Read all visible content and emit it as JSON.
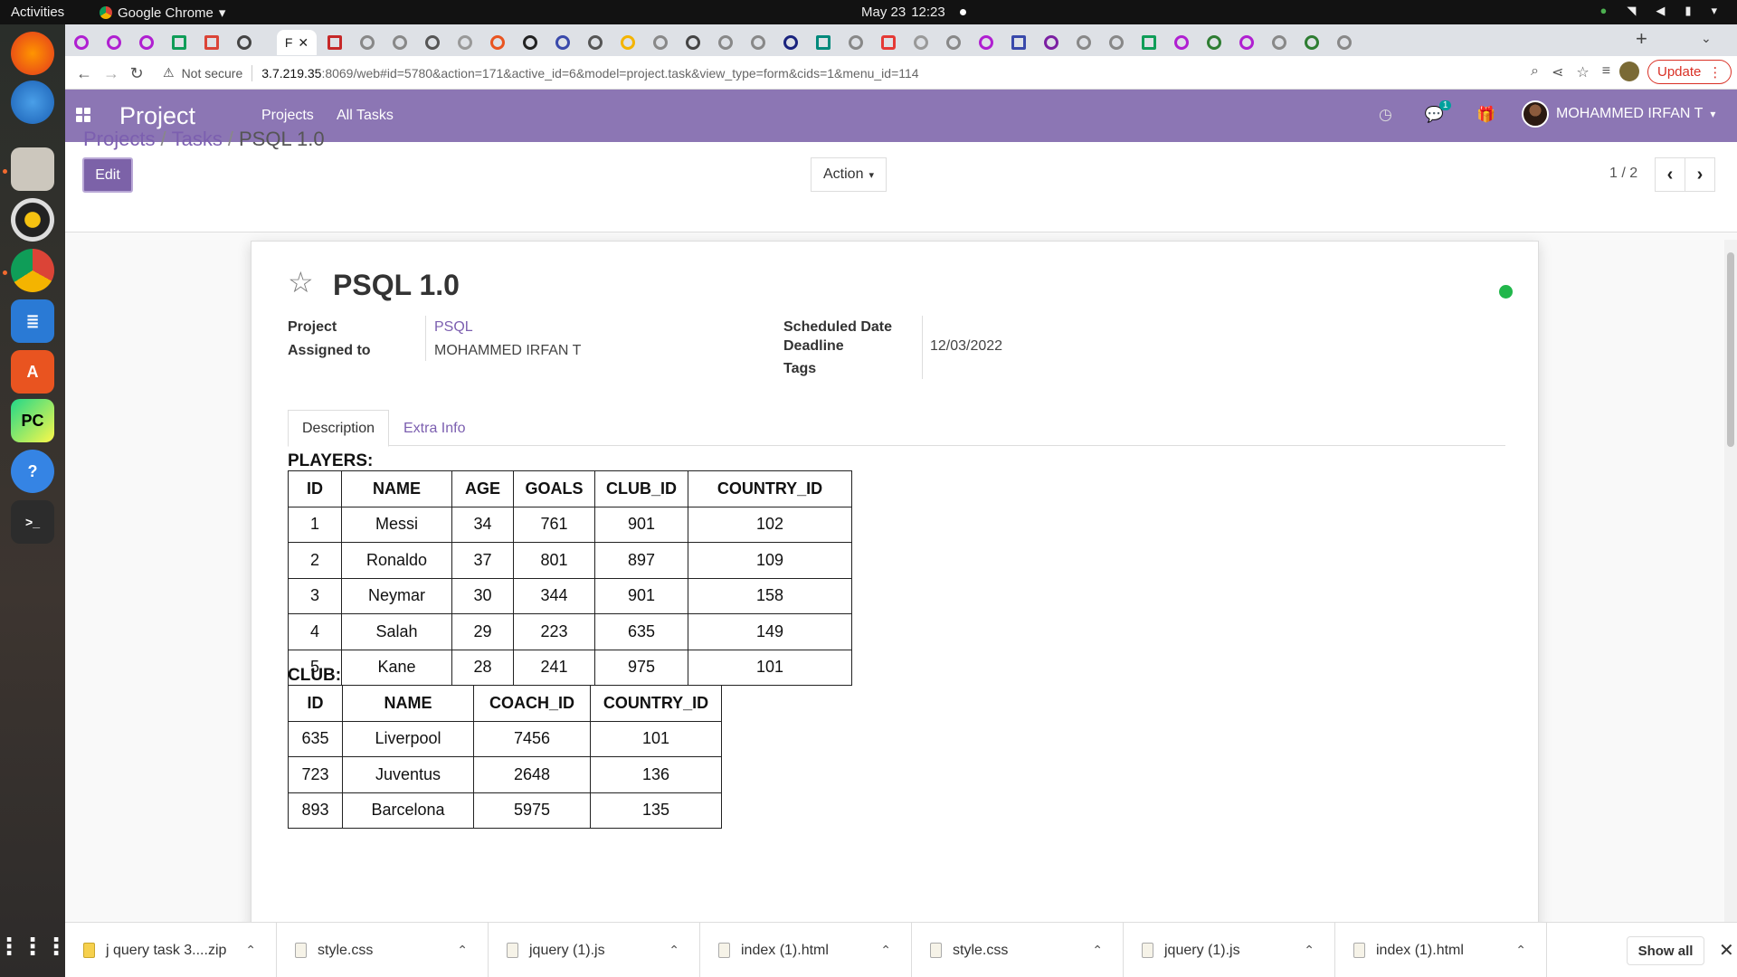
{
  "topbar": {
    "activities": "Activities",
    "app_name": "Google Chrome",
    "date": "May 23",
    "time": "12:23"
  },
  "browser": {
    "active_tab_label": "F",
    "url_security": "Not secure",
    "url_host": "3.7.219.35",
    "url_rest": ":8069/web#id=5780&action=171&active_id=6&model=project.task&view_type=form&cids=1&menu_id=114",
    "update_label": "Update"
  },
  "odoo_nav": {
    "app_title": "Project",
    "menu": [
      "Projects",
      "All Tasks"
    ],
    "chat_count": "1",
    "user_name": "MOHAMMED IRFAN T"
  },
  "breadcrumb": [
    "Projects",
    "Tasks",
    "PSQL 1.0"
  ],
  "control_panel": {
    "edit_label": "Edit",
    "action_label": "Action",
    "pager": "1 / 2"
  },
  "task": {
    "title": "PSQL 1.0",
    "fields_left": [
      {
        "label": "Project",
        "value": "PSQL"
      },
      {
        "label": "Assigned to",
        "value": "MOHAMMED IRFAN T"
      }
    ],
    "fields_right": [
      {
        "label": "Scheduled Date",
        "value": ""
      },
      {
        "label": "Deadline",
        "value": "12/03/2022"
      },
      {
        "label": "Tags",
        "value": ""
      }
    ],
    "tabs": [
      "Description",
      "Extra Info"
    ]
  },
  "description": {
    "players_title": "PLAYERS:",
    "players_headers": [
      "ID",
      "NAME",
      "AGE",
      "GOALS",
      "CLUB_ID",
      "COUNTRY_ID"
    ],
    "players_rows": [
      [
        "1",
        "Messi",
        "34",
        "761",
        "901",
        "102"
      ],
      [
        "2",
        "Ronaldo",
        "37",
        "801",
        "897",
        "109"
      ],
      [
        "3",
        "Neymar",
        "30",
        "344",
        "901",
        "158"
      ],
      [
        "4",
        "Salah",
        "29",
        "223",
        "635",
        "149"
      ],
      [
        "5",
        "Kane",
        "28",
        "241",
        "975",
        "101"
      ]
    ],
    "club_title": "CLUB:",
    "club_headers": [
      "ID",
      "NAME",
      "COACH_ID",
      "COUNTRY_ID"
    ],
    "club_rows": [
      [
        "635",
        "Liverpool",
        "7456",
        "101"
      ],
      [
        "723",
        "Juventus",
        "2648",
        "136"
      ],
      [
        "893",
        "Barcelona",
        "5975",
        "135"
      ]
    ]
  },
  "downloads": {
    "items": [
      "j query task 3....zip",
      "style.css",
      "jquery (1).js",
      "index (1).html",
      "style.css",
      "jquery (1).js",
      "index (1).html"
    ],
    "show_all": "Show all"
  },
  "colors": {
    "odoo_nav": "#8c76b4",
    "odoo_link": "#7c5fb0",
    "status_green": "#21b74b",
    "update_red": "#d93025"
  }
}
